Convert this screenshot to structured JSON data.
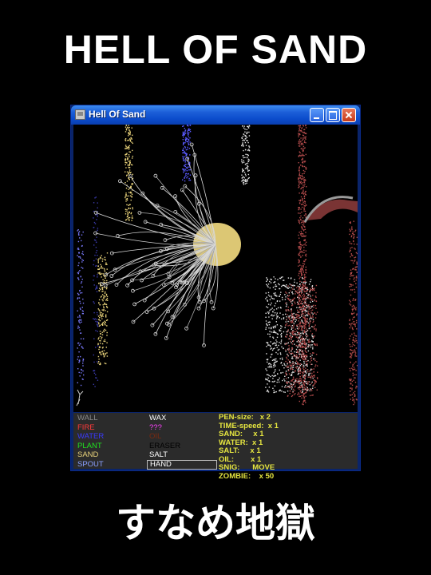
{
  "poster": {
    "title": "HELL OF SAND",
    "subtitle": "すなめ地獄"
  },
  "window": {
    "title": "Hell Of Sand",
    "icon": "app-icon",
    "buttons": [
      "minimize-icon",
      "maximize-icon",
      "close-icon"
    ]
  },
  "elements": {
    "col1": [
      {
        "label": "WALL",
        "color": "#8a8a8a"
      },
      {
        "label": "FIRE",
        "color": "#ff3a3a"
      },
      {
        "label": "WATER",
        "color": "#3a3aff"
      },
      {
        "label": "PLANT",
        "color": "#20e020"
      },
      {
        "label": "SAND",
        "color": "#e8d27a"
      },
      {
        "label": "SPOUT",
        "color": "#8aa0ff"
      }
    ],
    "col2": [
      {
        "label": "WAX",
        "color": "#ffffff"
      },
      {
        "label": "???",
        "color": "#ff40ff"
      },
      {
        "label": "OIL",
        "color": "#7a2a10"
      },
      {
        "label": "ERASER",
        "color": "#000000"
      },
      {
        "label": "SALT",
        "color": "#ffffff"
      },
      {
        "label": "HAND",
        "color": "#ffffff",
        "selected": true
      }
    ]
  },
  "status": [
    "PEN-size:   x 2",
    "TIME-speed:  x 1",
    "SAND:     x 1",
    "WATER:  x 1",
    "SALT:     x 1",
    "OIL:        x 1",
    "SNIG:      MOVE",
    "ZOMBIE:    x 50"
  ],
  "colors": {
    "titlebar": "#0b4ccc",
    "panel_bg": "#2b2b2b",
    "status_text": "#e6e640",
    "sand": "#e8d27a",
    "salt": "#e0e0e0",
    "plant": "#d8d8d8",
    "wax_blob": "#e8d27a",
    "dome": "#8a3a3a",
    "red_sand": "#b04a4a"
  }
}
